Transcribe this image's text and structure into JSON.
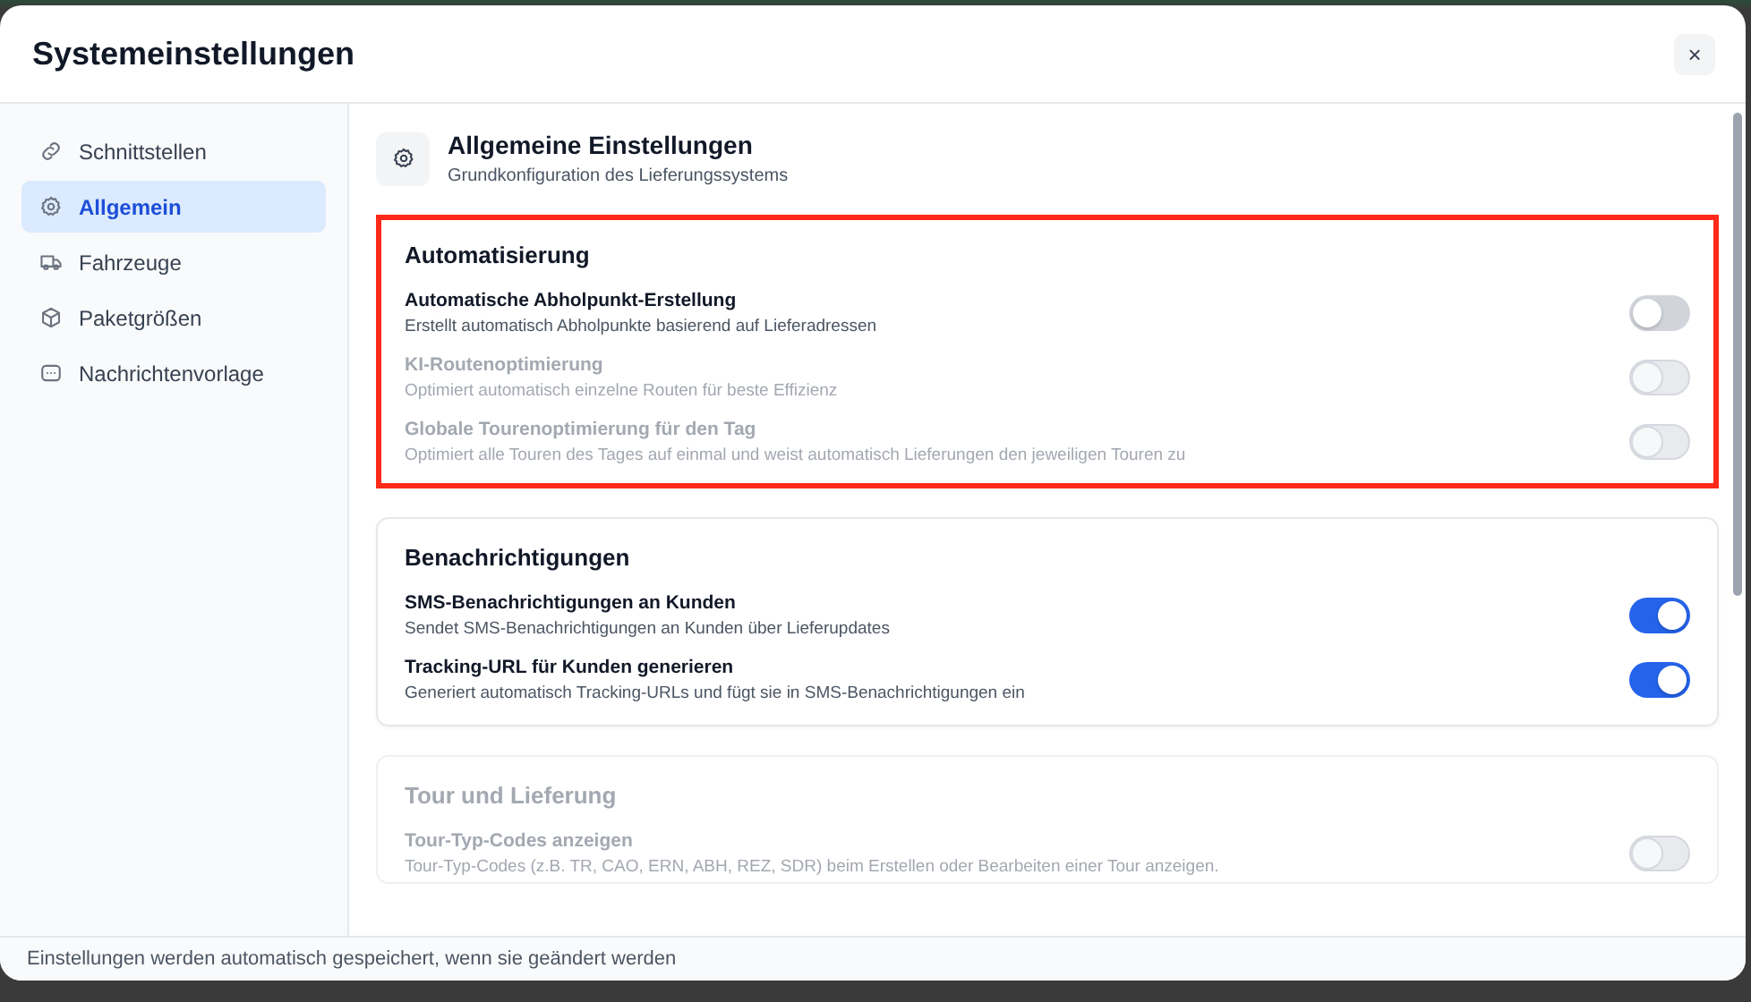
{
  "dialog": {
    "title": "Systemeinstellungen",
    "close_label": "×"
  },
  "sidebar": {
    "items": [
      {
        "label": "Schnittstellen",
        "selected": false
      },
      {
        "label": "Allgemein",
        "selected": true
      },
      {
        "label": "Fahrzeuge",
        "selected": false
      },
      {
        "label": "Paketgrößen",
        "selected": false
      },
      {
        "label": "Nachrichtenvorlage",
        "selected": false
      }
    ]
  },
  "page_header": {
    "title": "Allgemeine Einstellungen",
    "subtitle": "Grundkonfiguration des Lieferungssystems"
  },
  "sections": [
    {
      "title": "Automatisierung",
      "highlighted": true,
      "disabled": false,
      "settings": [
        {
          "label": "Automatische Abholpunkt-Erstellung",
          "description": "Erstellt automatisch Abholpunkte basierend auf Lieferadressen",
          "on": false,
          "disabled": false
        },
        {
          "label": "KI-Routenoptimierung",
          "description": "Optimiert automatisch einzelne Routen für beste Effizienz",
          "on": false,
          "disabled": true
        },
        {
          "label": "Globale Tourenoptimierung für den Tag",
          "description": "Optimiert alle Touren des Tages auf einmal und weist automatisch Lieferungen den jeweiligen Touren zu",
          "on": false,
          "disabled": true
        }
      ]
    },
    {
      "title": "Benachrichtigungen",
      "highlighted": false,
      "disabled": false,
      "settings": [
        {
          "label": "SMS-Benachrichtigungen an Kunden",
          "description": "Sendet SMS-Benachrichtigungen an Kunden über Lieferupdates",
          "on": true,
          "disabled": false
        },
        {
          "label": "Tracking-URL für Kunden generieren",
          "description": "Generiert automatisch Tracking-URLs und fügt sie in SMS-Benachrichtigungen ein",
          "on": true,
          "disabled": false
        }
      ]
    },
    {
      "title": "Tour und Lieferung",
      "highlighted": false,
      "disabled": true,
      "settings": [
        {
          "label": "Tour-Typ-Codes anzeigen",
          "description": "Tour-Typ-Codes (z.B. TR, CAO, ERN, ABH, REZ, SDR) beim Erstellen oder Bearbeiten einer Tour anzeigen.",
          "on": false,
          "disabled": true
        }
      ]
    }
  ],
  "footer": {
    "text": "Einstellungen werden automatisch gespeichert, wenn sie geändert werden"
  }
}
